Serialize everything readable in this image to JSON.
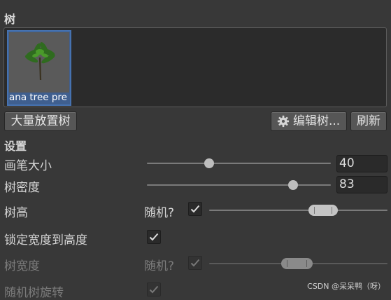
{
  "tree_section": {
    "title": "树",
    "items": [
      {
        "name": "ana tree pre"
      }
    ]
  },
  "toolbar": {
    "mass_place_label": "大量放置树",
    "edit_trees_label": "编辑树...",
    "refresh_label": "刷新"
  },
  "settings": {
    "title": "设置",
    "brush_size": {
      "label": "画笔大小",
      "value": "40",
      "slider_fraction": 0.34
    },
    "tree_density": {
      "label": "树密度",
      "value": "83",
      "slider_fraction": 0.795
    },
    "tree_height": {
      "label": "树高",
      "random_label": "随机?",
      "random_checked": true,
      "range_fraction": [
        0.555,
        0.72
      ]
    },
    "lock_width_to_height": {
      "label": "锁定宽度到高度",
      "checked": true
    },
    "tree_width": {
      "label": "树宽度",
      "random_label": "随机?",
      "random_checked": true,
      "disabled": true,
      "range_fraction": [
        0.405,
        0.58
      ]
    },
    "random_rotation": {
      "label": "随机树旋转",
      "checked": true,
      "disabled": true
    }
  },
  "watermark": "CSDN @呆呆鸭（呀）",
  "colors": {
    "background": "#383838",
    "selection": "#3f5f8f",
    "selection_border": "#4672b0",
    "field": "#2a2a2a"
  },
  "icons": {
    "edit_trees": "gear-icon",
    "checkbox": "checkmark-icon"
  }
}
